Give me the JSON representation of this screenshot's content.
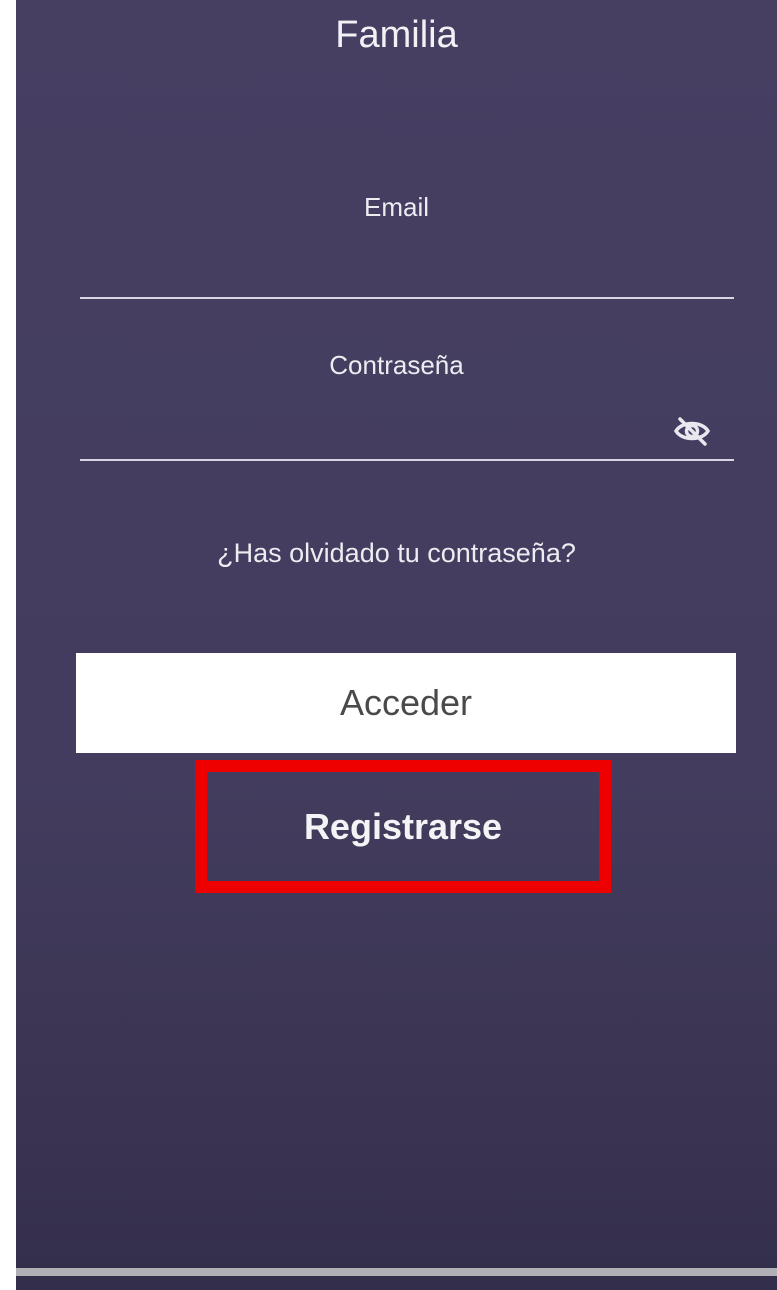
{
  "header": {
    "title": "Familia"
  },
  "form": {
    "email_label": "Email",
    "email_value": "",
    "password_label": "Contraseña",
    "password_value": "",
    "password_toggle_icon": "eye-off-icon",
    "forgot_password": "¿Has olvidado tu contraseña?"
  },
  "actions": {
    "login_label": "Acceder",
    "register_label": "Registrarse",
    "register_highlight_color": "#ee0000"
  },
  "theme": {
    "background": "#433c5e",
    "text": "#ffffff",
    "button_bg": "#ffffff",
    "button_text": "#4a4a4a"
  }
}
